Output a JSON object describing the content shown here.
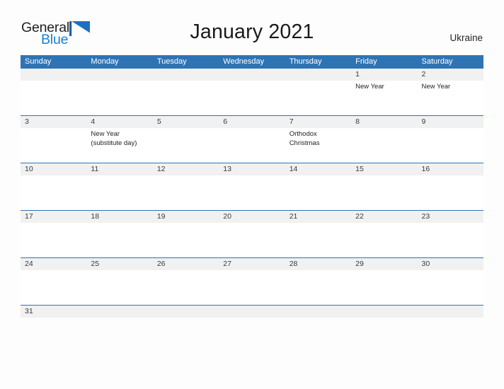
{
  "brand": {
    "name_part1": "General",
    "name_part2": "Blue",
    "flag_icon": "blue-triangle-flag-icon",
    "color_dark": "#231f20",
    "color_blue": "#1b7fd4"
  },
  "header": {
    "title": "January 2021",
    "country": "Ukraine"
  },
  "theme": {
    "header_blue": "#2e74b5",
    "date_band_gray": "#f1f1f1",
    "page_background": "#fdfdfd",
    "text_color": "#1f1f1f"
  },
  "calendar": {
    "weekdays": [
      "Sunday",
      "Monday",
      "Tuesday",
      "Wednesday",
      "Thursday",
      "Friday",
      "Saturday"
    ],
    "weeks": [
      {
        "days": [
          {
            "number": "",
            "events": []
          },
          {
            "number": "",
            "events": []
          },
          {
            "number": "",
            "events": []
          },
          {
            "number": "",
            "events": []
          },
          {
            "number": "",
            "events": []
          },
          {
            "number": "1",
            "events": [
              "New Year"
            ]
          },
          {
            "number": "2",
            "events": [
              "New Year"
            ]
          }
        ]
      },
      {
        "days": [
          {
            "number": "3",
            "events": []
          },
          {
            "number": "4",
            "events": [
              "New Year\n(substitute day)"
            ]
          },
          {
            "number": "5",
            "events": []
          },
          {
            "number": "6",
            "events": []
          },
          {
            "number": "7",
            "events": [
              "Orthodox\nChristmas"
            ]
          },
          {
            "number": "8",
            "events": []
          },
          {
            "number": "9",
            "events": []
          }
        ]
      },
      {
        "days": [
          {
            "number": "10",
            "events": []
          },
          {
            "number": "11",
            "events": []
          },
          {
            "number": "12",
            "events": []
          },
          {
            "number": "13",
            "events": []
          },
          {
            "number": "14",
            "events": []
          },
          {
            "number": "15",
            "events": []
          },
          {
            "number": "16",
            "events": []
          }
        ]
      },
      {
        "days": [
          {
            "number": "17",
            "events": []
          },
          {
            "number": "18",
            "events": []
          },
          {
            "number": "19",
            "events": []
          },
          {
            "number": "20",
            "events": []
          },
          {
            "number": "21",
            "events": []
          },
          {
            "number": "22",
            "events": []
          },
          {
            "number": "23",
            "events": []
          }
        ]
      },
      {
        "days": [
          {
            "number": "24",
            "events": []
          },
          {
            "number": "25",
            "events": []
          },
          {
            "number": "26",
            "events": []
          },
          {
            "number": "27",
            "events": []
          },
          {
            "number": "28",
            "events": []
          },
          {
            "number": "29",
            "events": []
          },
          {
            "number": "30",
            "events": []
          }
        ]
      },
      {
        "short": true,
        "days": [
          {
            "number": "31",
            "events": []
          },
          {
            "number": "",
            "events": []
          },
          {
            "number": "",
            "events": []
          },
          {
            "number": "",
            "events": []
          },
          {
            "number": "",
            "events": []
          },
          {
            "number": "",
            "events": []
          },
          {
            "number": "",
            "events": []
          }
        ]
      }
    ]
  }
}
